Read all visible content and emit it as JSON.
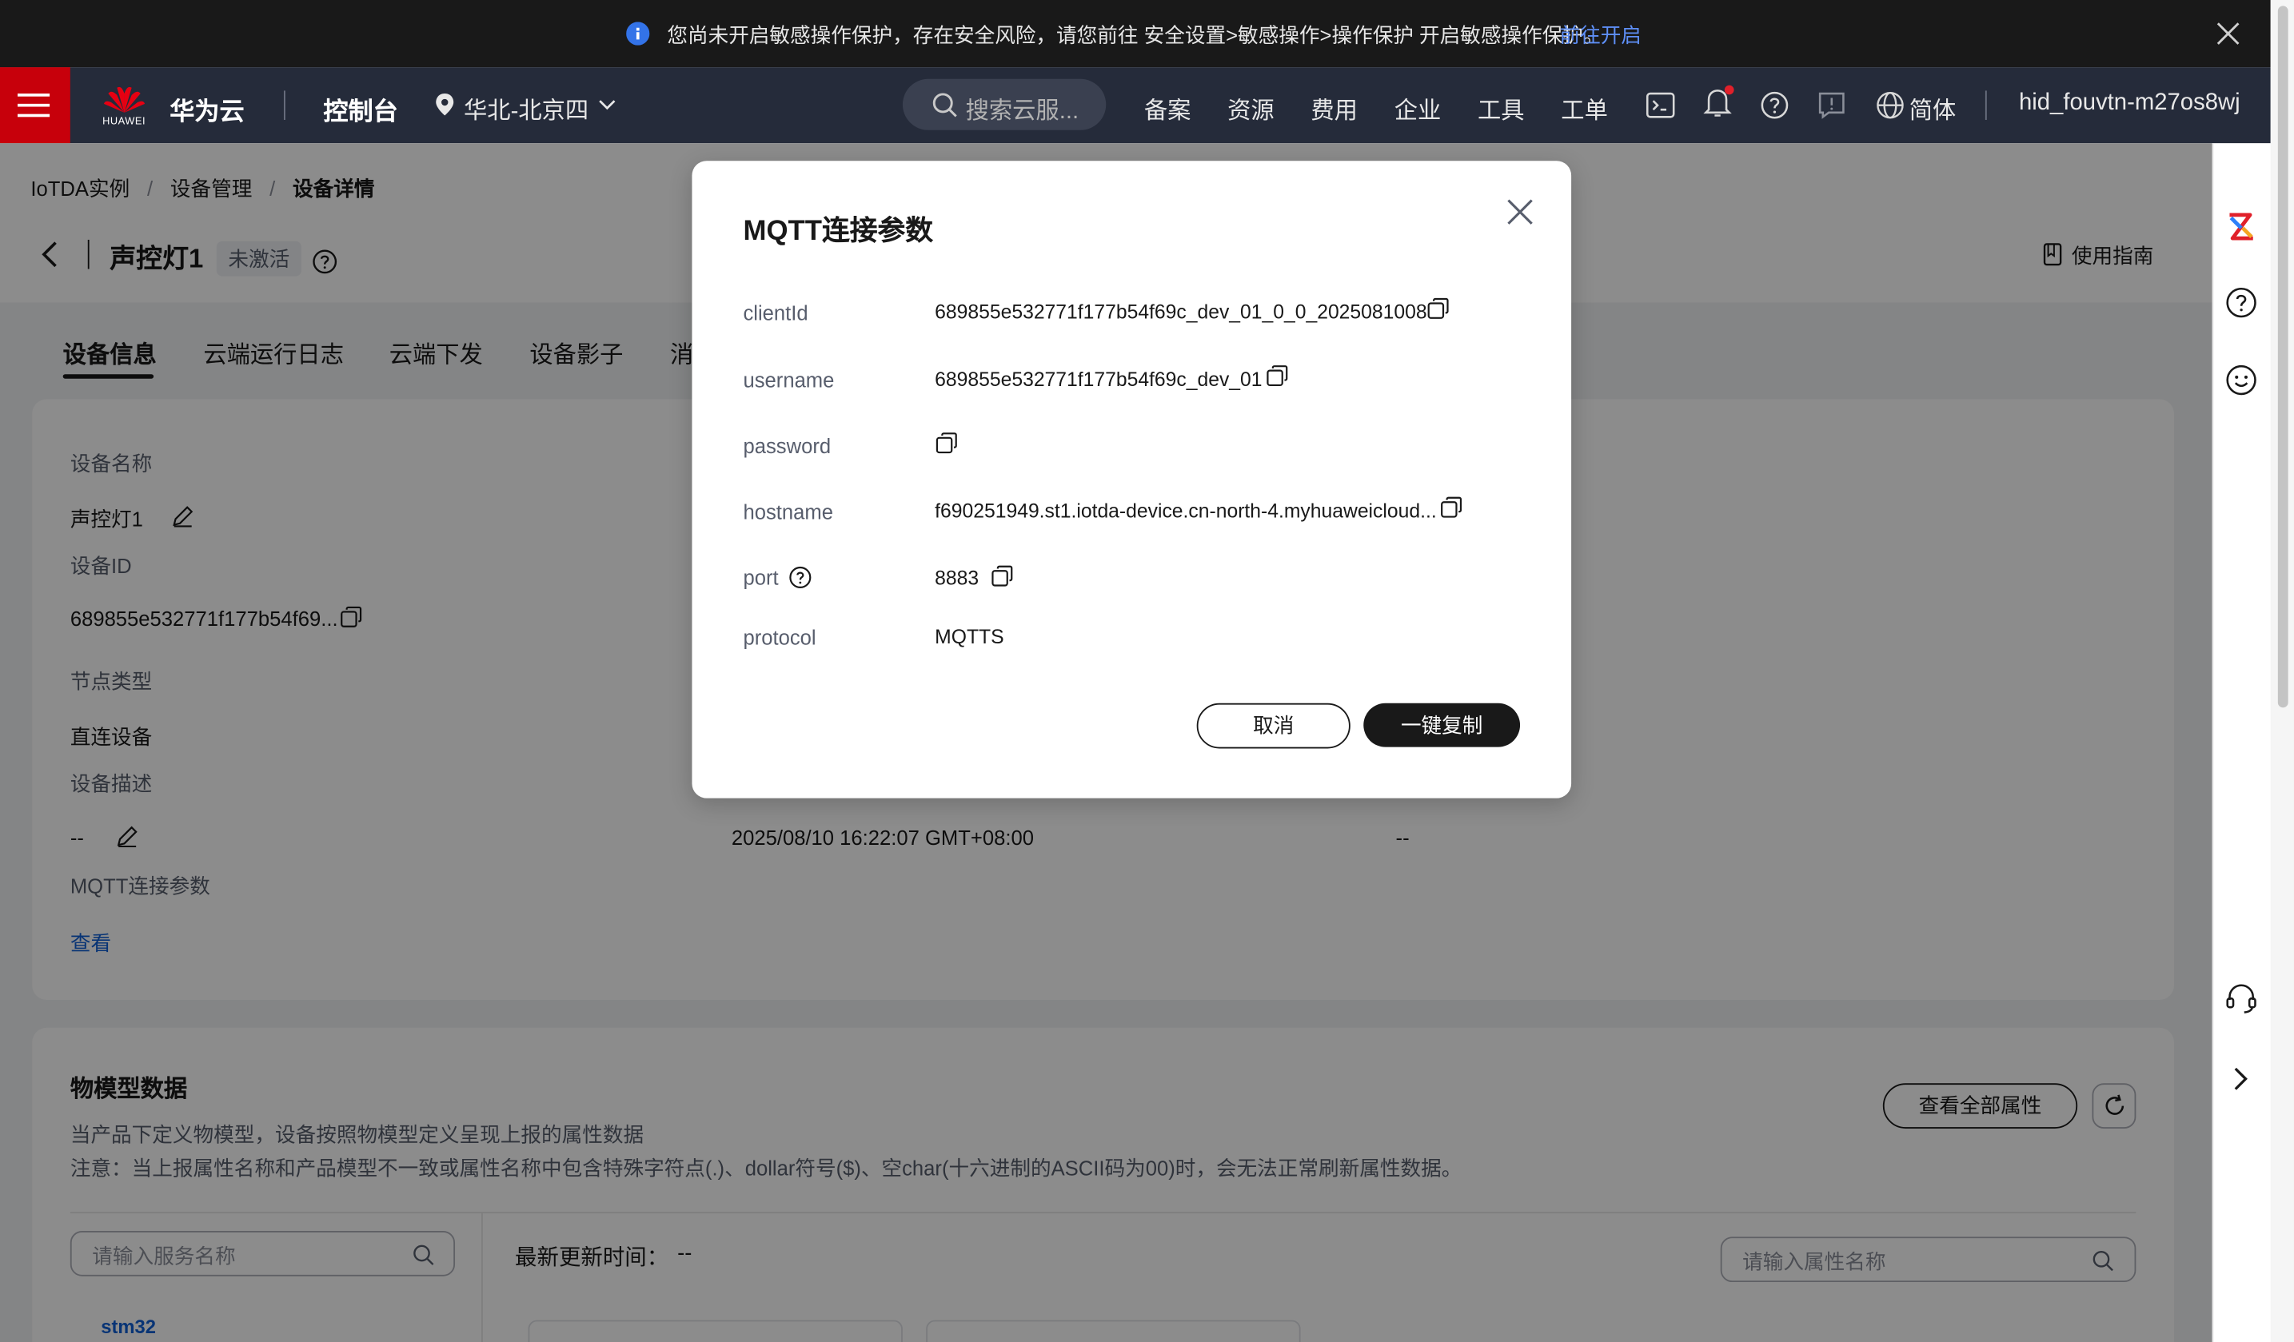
{
  "banner": {
    "message": "您尚未开启敏感操作保护，存在安全风险，请您前往 安全设置>敏感操作>操作保护 开启敏感操作保护。",
    "link": "前往开启"
  },
  "topnav": {
    "brand_sub": "HUAWEI",
    "brand": "华为云",
    "console": "控制台",
    "region": "华北-北京四",
    "search_placeholder": "搜索云服...",
    "links": [
      "备案",
      "资源",
      "费用",
      "企业",
      "工具",
      "工单"
    ],
    "language": "简体",
    "user": "hid_fouvtn-m27os8wj"
  },
  "breadcrumb": [
    "IoTDA实例",
    "设备管理",
    "设备详情"
  ],
  "header": {
    "title": "声控灯1",
    "status": "未激活",
    "guide": "使用指南"
  },
  "tabs": [
    "设备信息",
    "云端运行日志",
    "云端下发",
    "设备影子",
    "消"
  ],
  "device_info": {
    "name_label": "设备名称",
    "name_value": "声控灯1",
    "id_label": "设备ID",
    "id_value": "689855e532771f177b54f69...",
    "node_label": "节点类型",
    "node_value": "直连设备",
    "desc_label": "设备描述",
    "desc_value": "--",
    "mqtt_label": "MQTT连接参数",
    "mqtt_link": "查看",
    "time_value": "2025/08/10 16:22:07 GMT+08:00",
    "extra_value": "--"
  },
  "model_data": {
    "title": "物模型数据",
    "desc1": "当产品下定义物模型，设备按照物模型定义呈现上报的属性数据",
    "desc2": "注意：当上报属性名称和产品模型不一致或属性名称中包含特殊字符点(.)、dollar符号($)、空char(十六进制的ASCII码为00)时，会无法正常刷新属性数据。",
    "view_all": "查看全部属性",
    "service_placeholder": "请输入服务名称",
    "latest_update_label": "最新更新时间：",
    "latest_update_value": "--",
    "property_placeholder": "请输入属性名称",
    "service_item": "stm32"
  },
  "dialog": {
    "title": "MQTT连接参数",
    "rows": [
      {
        "label": "clientId",
        "value": "689855e532771f177b54f69c_dev_01_0_0_2025081008"
      },
      {
        "label": "username",
        "value": "689855e532771f177b54f69c_dev_01"
      },
      {
        "label": "password",
        "value": ""
      },
      {
        "label": "hostname",
        "value": "f690251949.st1.iotda-device.cn-north-4.myhuaweicloud..."
      },
      {
        "label": "port",
        "value": "8883"
      },
      {
        "label": "protocol",
        "value": "MQTTS"
      }
    ],
    "cancel": "取消",
    "copy_all": "一键复制"
  }
}
